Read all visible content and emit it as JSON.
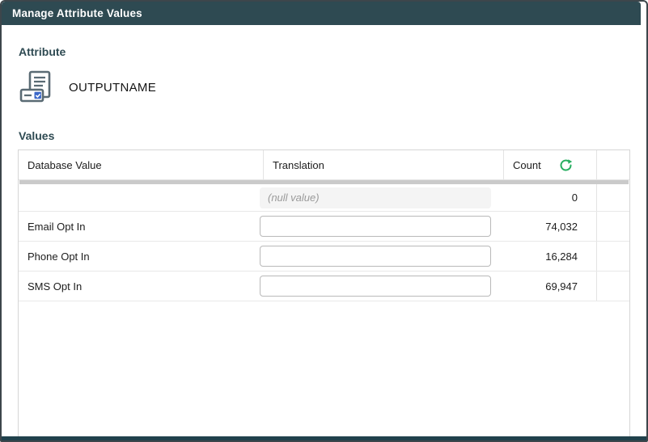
{
  "window": {
    "title": "Manage Attribute Values"
  },
  "attribute": {
    "label": "Attribute",
    "name": "OUTPUTNAME"
  },
  "values": {
    "label": "Values"
  },
  "table": {
    "columns": [
      "Database Value",
      "Translation",
      "Count"
    ],
    "rows": [
      {
        "database_value": "",
        "translation_value": "",
        "translation_placeholder": "(null value)",
        "translation_disabled": true,
        "count": "0"
      },
      {
        "database_value": "Email Opt In",
        "translation_value": "",
        "count": "74,032"
      },
      {
        "database_value": "Phone Opt In",
        "translation_value": "",
        "count": "16,284"
      },
      {
        "database_value": "SMS Opt In",
        "translation_value": "",
        "count": "69,947"
      }
    ]
  },
  "colors": {
    "titlebar_bg": "#2e4a52",
    "section_label": "#2e4a52",
    "refresh_green": "#27ae60",
    "checkbox_blue": "#3a67c8",
    "bottombar_bg": "#20414c",
    "icon_slate": "#5a6b74"
  }
}
